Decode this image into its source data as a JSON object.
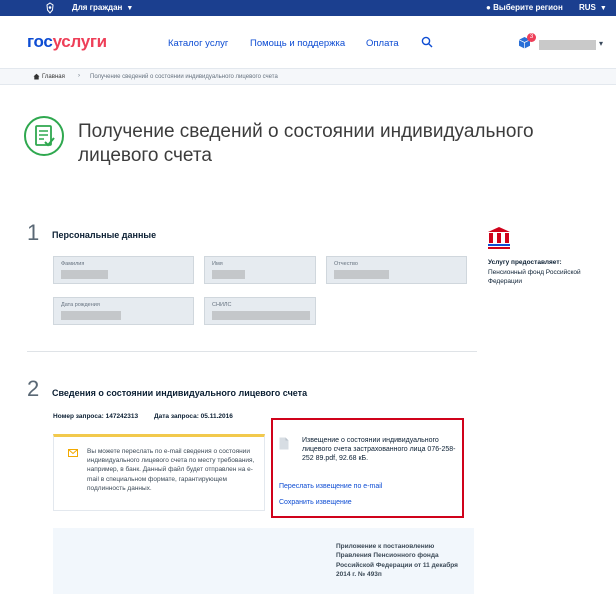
{
  "topbar": {
    "citizens": "Для граждан",
    "region": "Выберите регион",
    "lang": "RUS"
  },
  "header": {
    "logo_part1": "гос",
    "logo_part2": "услуги",
    "nav": [
      "Каталог услуг",
      "Помощь и поддержка",
      "Оплата"
    ],
    "cart_count": "3"
  },
  "breadcrumb": {
    "home": "Главная",
    "separator": "›",
    "current": "Получение сведений о состоянии индивидуального лицевого счета"
  },
  "page": {
    "title": "Получение сведений о состоянии индивидуального лицевого счета"
  },
  "step1": {
    "number": "1",
    "title": "Персональные данные",
    "fields": {
      "surname": "Фамилия",
      "name": "Имя",
      "patronymic": "Отчество",
      "birthdate": "Дата рождения",
      "snils": "СНИЛС"
    }
  },
  "provider": {
    "title": "Услугу предоставляет:",
    "name": "Пенсионный фонд Российской Федерации"
  },
  "step2": {
    "number": "2",
    "title": "Сведения о состоянии индивидуального лицевого счета",
    "request_number": "Номер запроса: 147242313",
    "request_date": "Дата запроса: 05.11.2016",
    "notice": "Вы можете переслать по e-mail сведения о состоянии индивидуального лицевого счета по месту требования, например, в банк. Данный файл будет отправлен на e-mail в специальном формате, гарантирующем подлинность данных.",
    "file_name": "Извещение о состоянии индивидуального лицевого счета застрахованного лица 076-258-252 89.pdf, 92.68 кБ.",
    "send_link": "Переслать извещение по e-mail",
    "save_link": "Сохранить извещение",
    "appendix": "Приложение к постановлению Правления Пенсионного фонда Российской Федерации от 11 декабря 2014 г. № 493п"
  },
  "colors": {
    "topbar": "#1b3f8f",
    "accent_blue": "#0d4cd3",
    "accent_red": "#ee3f58",
    "highlight_border": "#d0021b",
    "notice_stripe": "#f2c94c"
  }
}
